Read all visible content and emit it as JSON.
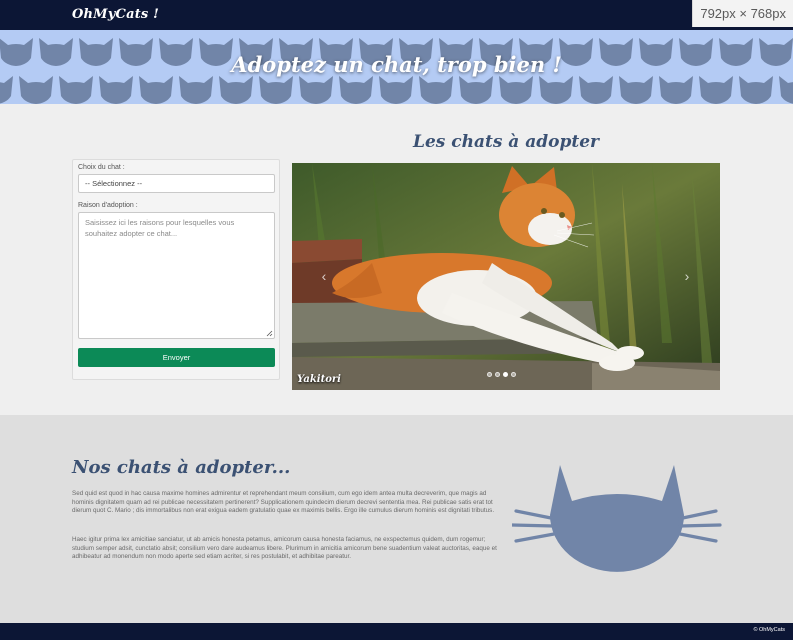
{
  "navbar": {
    "brand": "OhMyCats !",
    "viewport_badge": "792px × 768px"
  },
  "hero": {
    "title": "Adoptez un chat, trop bien !"
  },
  "adoption_form": {
    "cat_choice_label": "Choix du chat :",
    "cat_choice_selected": "-- Sélectionnez --",
    "reason_label": "Raison d'adoption :",
    "reason_placeholder": "Saisissez ici les raisons pour lesquelles vous souhaitez adopter ce chat...",
    "submit_label": "Envoyer"
  },
  "carousel": {
    "title": "Les chats à adopter",
    "slide_caption": "Yakitori",
    "slide_count": 4,
    "active_slide": 3
  },
  "about": {
    "title": "Nos chats à adopter...",
    "paragraph_1": "Sed quid est quod in hac causa maxime homines admirentur et reprehendant meum consilium, cum ego idem antea multa decreverim, que magis ad hominis dignitatem quam ad rei publicae necessitatem pertinerent? Supplicationem quindecim dierum decrevi sententia mea. Rei publicae satis erat tot dierum quot C. Mario ; dis immortalibus non erat exigua eadem gratulatio quae ex maximis bellis. Ergo ille cumulus dierum hominis est dignitati tributus.",
    "paragraph_2": "Haec igitur prima lex amicitiae sanciatur, ut ab amicis honesta petamus, amicorum causa honesta faciamus, ne exspectemus quidem, dum rogemur; studium semper adsit, cunctatio absit; consilium vero dare audeamus libere. Plurimum in amicitia amicorum bene suadentium valeat auctoritas, eaque et adhibeatur ad monendum non modo aperte sed etiam acriter, si res postulabit, et adhibitae pareatur."
  },
  "footer": {
    "copyright": "© OhMyCats"
  },
  "colors": {
    "navbar_bg": "#0c1635",
    "hero_bg": "#b4cbf4",
    "cat_silhouette": "#7185a8",
    "heading": "#3b5173",
    "button": "#0c8a57"
  }
}
